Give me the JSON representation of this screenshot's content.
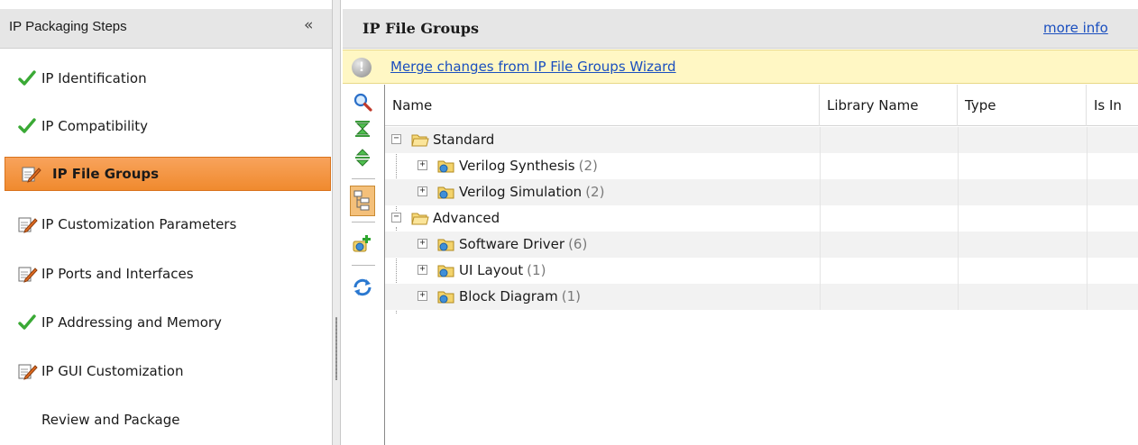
{
  "left_panel": {
    "title": "IP Packaging Steps",
    "collapse_glyph": "«",
    "steps": [
      {
        "label": "IP Identification",
        "status": "done"
      },
      {
        "label": "IP Compatibility",
        "status": "done"
      },
      {
        "label": "IP File Groups",
        "status": "edited",
        "active": true
      },
      {
        "label": "IP Customization Parameters",
        "status": "edited"
      },
      {
        "label": "IP Ports and Interfaces",
        "status": "edited"
      },
      {
        "label": "IP Addressing and Memory",
        "status": "done"
      },
      {
        "label": "IP GUI Customization",
        "status": "edited"
      },
      {
        "label": "Review and Package",
        "status": "none"
      }
    ]
  },
  "right_panel": {
    "title": "IP File Groups",
    "more_info": "more info",
    "banner": {
      "icon": "info-icon",
      "glyph": "!",
      "link": "Merge changes from IP File Groups Wizard"
    },
    "toolbar": [
      "search-icon",
      "collapse-all-icon",
      "expand-all-icon",
      "group-view-icon",
      "add-file-group-icon",
      "refresh-icon"
    ],
    "columns": [
      "Name",
      "Library Name",
      "Type",
      "Is In"
    ],
    "tree": [
      {
        "label": "Standard",
        "count": "",
        "level": 0,
        "expander": "−"
      },
      {
        "label": "Verilog Synthesis",
        "count": "(2)",
        "level": 1,
        "expander": "+"
      },
      {
        "label": "Verilog Simulation",
        "count": "(2)",
        "level": 1,
        "expander": "+"
      },
      {
        "label": "Advanced",
        "count": "",
        "level": 0,
        "expander": "−"
      },
      {
        "label": "Software Driver",
        "count": "(6)",
        "level": 1,
        "expander": "+"
      },
      {
        "label": "UI Layout",
        "count": "(1)",
        "level": 1,
        "expander": "+"
      },
      {
        "label": "Block Diagram",
        "count": "(1)",
        "level": 1,
        "expander": "+"
      }
    ]
  },
  "colors": {
    "active_step": "#f08a2e",
    "link": "#1a4fbf",
    "banner_bg": "#fff7c4",
    "check": "#3aa935"
  }
}
